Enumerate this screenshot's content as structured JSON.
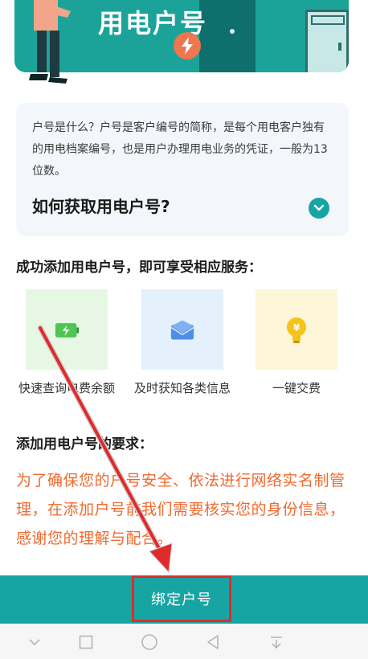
{
  "banner": {
    "title": "用电户号",
    "bolt_icon": "lightning-bolt-icon"
  },
  "info_card": {
    "description": "户号是什么？户号是客户编号的简称，是每个用电客户独有的用电档案编号，也是用户办理用电业务的凭证，一般为13位数。",
    "faq_title": "如何获取用电户号?",
    "toggle_icon": "chevron-down-icon"
  },
  "services": {
    "heading": "成功添加用电户号，即可享受相应服务：",
    "items": [
      {
        "label": "快速查询电费余额",
        "icon": "battery-charge-icon",
        "bg": "#e6f8e4"
      },
      {
        "label": "及时获知各类信息",
        "icon": "envelope-icon",
        "bg": "#e4f1fc"
      },
      {
        "label": "一键交费",
        "icon": "lightbulb-yuan-icon",
        "bg": "#fdf6d8"
      }
    ]
  },
  "requirements": {
    "heading": "添加用电户号的要求：",
    "text": "为了确保您的户号安全、依法进行网络实名制管理，在添加户号前我们需要核实您的身份信息，感谢您的理解与配合。"
  },
  "bind_button": {
    "label": "绑定户号"
  },
  "colors": {
    "accent": "#17a5a3",
    "warning_text": "#f06a30",
    "highlight_box": "#e12b2b"
  }
}
